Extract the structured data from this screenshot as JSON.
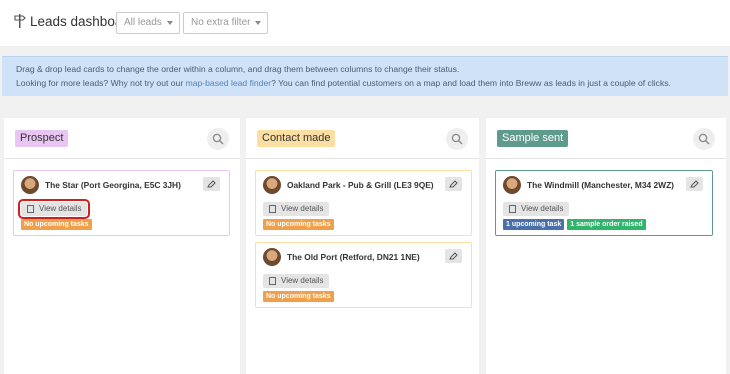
{
  "header": {
    "title": "Leads dashboard",
    "title_icon": "signpost-icon",
    "filter_leads": "All leads",
    "filter_extra": "No extra filter"
  },
  "info": {
    "line1": "Drag & drop lead cards to change the order within a column, and drag them between columns to change their status.",
    "line2_before": "Looking for more leads? Why not try out our ",
    "line2_link": "map-based lead finder",
    "line2_after": "? You can find potential customers on a map and load them into Breww as leads in just a couple of clicks."
  },
  "columns": [
    {
      "title": "Prospect",
      "color": "#e9c5f3",
      "cards": [
        {
          "name": "The Star (Port Georgina, E5C 3JH)",
          "view_label": "View details",
          "tags": [
            "No upcoming tasks"
          ]
        }
      ]
    },
    {
      "title": "Contact made",
      "color": "#fbdfa2",
      "cards": [
        {
          "name": "Oakland Park - Pub & Grill (LE3 9QE)",
          "view_label": "View details",
          "tags": [
            "No upcoming tasks"
          ]
        },
        {
          "name": "The Old Port (Retford, DN21 1NE)",
          "view_label": "View details",
          "tags": [
            "No upcoming tasks"
          ]
        }
      ]
    },
    {
      "title": "Sample sent",
      "color": "#5e9b8c",
      "cards": [
        {
          "name": "The Windmill (Manchester, M34 2WZ)",
          "view_label": "View details",
          "tags": [
            "1 upcoming task",
            "1 sample order raised"
          ]
        }
      ]
    }
  ],
  "colors": {
    "tag_orange": "#f0a04b",
    "tag_blue": "#4b6fa8",
    "tag_green": "#31b46c",
    "highlight": "#d0201f"
  }
}
